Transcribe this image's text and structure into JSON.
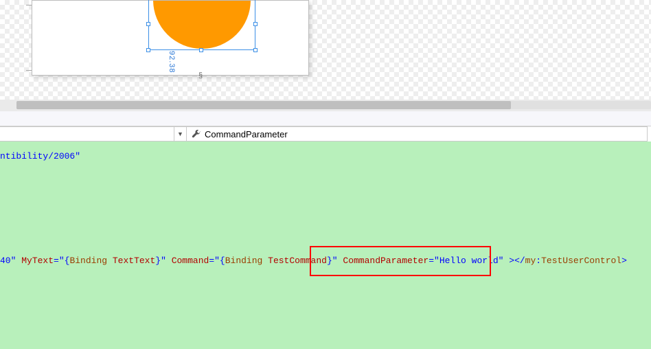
{
  "designer": {
    "dimension_label": "92.38",
    "expand_glyph": "§"
  },
  "member_bar": {
    "selected_member": "CommandParameter"
  },
  "xaml": {
    "line1_text": "ntibility/2006\"",
    "line2": {
      "frag1": "40\"",
      "attr1": "MyText",
      "val1_open": "=\"{",
      "val1_kw": "Binding",
      "val1_sp": " ",
      "val1_path": "TextText",
      "val1_close": "}\"",
      "attr2": "Command",
      "val2_open": "=\"{",
      "val2_kw": "Binding",
      "val2_sp": " ",
      "val2_path": "TestCommand",
      "val2_close": "}\"",
      "attr3": "CommandParameter",
      "val3_eq": "=",
      "val3": "\"Hello world\"",
      "tag_gt": " >",
      "close_open": "</",
      "close_prefix": "my",
      "close_colon": ":",
      "close_name": "TestUserControl",
      "close_gt": ">"
    }
  }
}
